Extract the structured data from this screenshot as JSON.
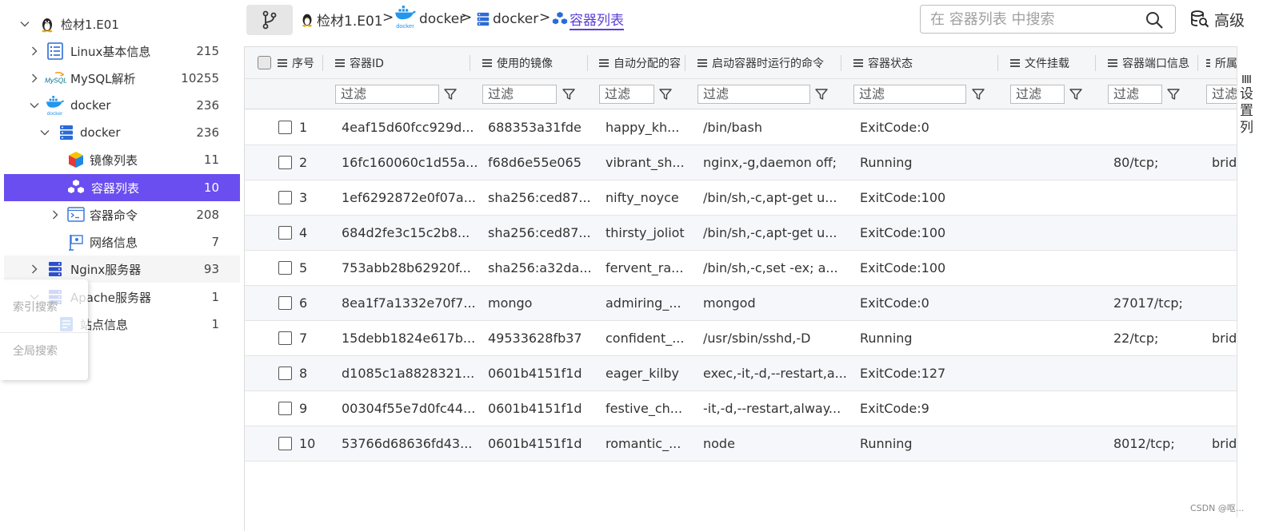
{
  "sidebar": {
    "nodes": [
      {
        "label": "检材1.E01",
        "count": ""
      },
      {
        "label": "Linux基本信息",
        "count": "215"
      },
      {
        "label": "MySQL解析",
        "count": "10255"
      },
      {
        "label": "docker",
        "count": "236"
      },
      {
        "label": "docker",
        "count": "236"
      },
      {
        "label": "镜像列表",
        "count": "11"
      },
      {
        "label": "容器列表",
        "count": "10"
      },
      {
        "label": "容器命令",
        "count": "208"
      },
      {
        "label": "网络信息",
        "count": "7"
      },
      {
        "label": "Nginx服务器",
        "count": "93"
      },
      {
        "label": "Apache服务器",
        "count": "1"
      },
      {
        "label": "站点信息",
        "count": "1"
      }
    ],
    "mysql_logo_text": "MySQL",
    "docker_logo_text": "docker"
  },
  "float_panel": {
    "index_search": "索引搜索",
    "global_search": "全局搜索"
  },
  "breadcrumb": [
    {
      "label": "检材1.E01"
    },
    {
      "label": "docker",
      "logo_text": "docker"
    },
    {
      "label": "docker"
    },
    {
      "label": "容器列表"
    }
  ],
  "breadcrumb_separator": ">",
  "search": {
    "placeholder": "在 容器列表 中搜索"
  },
  "advanced_label": "高级",
  "table": {
    "columns": [
      "序号",
      "容器ID",
      "使用的镜像",
      "自动分配的容",
      "启动容器时运行的命令",
      "容器状态",
      "文件挂载",
      "容器端口信息",
      "所属"
    ],
    "filter_placeholder": "过滤",
    "rows": [
      [
        "1",
        "4eaf15d60fcc929d...",
        "688353a31fde",
        "happy_kh...",
        "/bin/bash",
        "ExitCode:0",
        "",
        "",
        ""
      ],
      [
        "2",
        "16fc160060c1d55a...",
        "f68d6e55e065",
        "vibrant_sh...",
        "nginx,-g,daemon off;",
        "Running",
        "",
        "80/tcp;",
        "brid"
      ],
      [
        "3",
        "1ef6292872e0f07a...",
        "sha256:ced87...",
        "nifty_noyce",
        "/bin/sh,-c,apt-get u...",
        "ExitCode:100",
        "",
        "",
        ""
      ],
      [
        "4",
        "684d2fe3c15c2b8...",
        "sha256:ced87...",
        "thirsty_joliot",
        "/bin/sh,-c,apt-get u...",
        "ExitCode:100",
        "",
        "",
        ""
      ],
      [
        "5",
        "753abb28b62920f...",
        "sha256:a32da...",
        "fervent_ra...",
        "/bin/sh,-c,set -ex; a...",
        "ExitCode:100",
        "",
        "",
        ""
      ],
      [
        "6",
        "8ea1f7a1332e70f7...",
        "mongo",
        "admiring_...",
        "mongod",
        "ExitCode:0",
        "",
        "27017/tcp;",
        ""
      ],
      [
        "7",
        "15debb1824e617b...",
        "49533628fb37",
        "confident_...",
        "/usr/sbin/sshd,-D",
        "Running",
        "",
        "22/tcp;",
        "brid"
      ],
      [
        "8",
        "d1085c1a8828321...",
        "0601b4151f1d",
        "eager_kilby",
        "exec,-it,-d,--restart,a...",
        "ExitCode:127",
        "",
        "",
        ""
      ],
      [
        "9",
        "00304f55e7d0fc44...",
        "0601b4151f1d",
        "festive_ch...",
        "-it,-d,--restart,alway...",
        "ExitCode:9",
        "",
        "",
        ""
      ],
      [
        "10",
        "53766d68636fd43...",
        "0601b4151f1d",
        "romantic_...",
        "node",
        "Running",
        "",
        "8012/tcp;",
        "brid"
      ]
    ]
  },
  "column_settings_label": "设置列",
  "watermark": "CSDN @呕...",
  "colors": {
    "accent": "#6a4ef0",
    "link": "#5b3fd8",
    "row_alt": "#f5f7fa",
    "header_bg": "#f5f6f7"
  }
}
